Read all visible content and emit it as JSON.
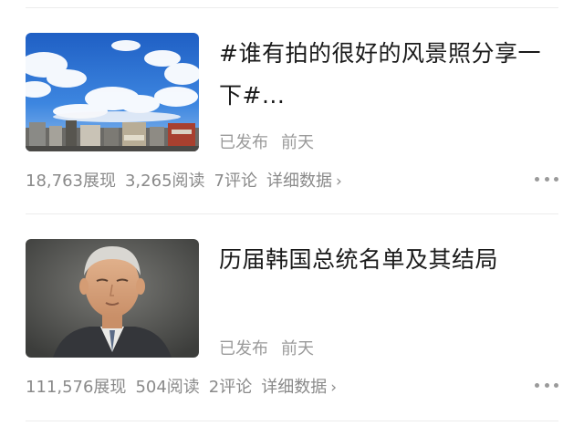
{
  "articles": [
    {
      "title": "#谁有拍的很好的风景照分享一下#...",
      "status": "已发布",
      "time": "前天",
      "stats": {
        "views": "18,763展现",
        "reads": "3,265阅读",
        "comments": "7评论"
      },
      "detail_label": "详细数据",
      "thumbnail_icon": "sky-cityscape-photo"
    },
    {
      "title": "历届韩国总统名单及其结局",
      "status": "已发布",
      "time": "前天",
      "stats": {
        "views": "111,576展现",
        "reads": "504阅读",
        "comments": "2评论"
      },
      "detail_label": "详细数据",
      "thumbnail_icon": "elderly-man-portrait-photo"
    }
  ],
  "colors": {
    "title": "#1a1a1a",
    "meta": "#9a9a9a",
    "divider": "#ececec"
  }
}
